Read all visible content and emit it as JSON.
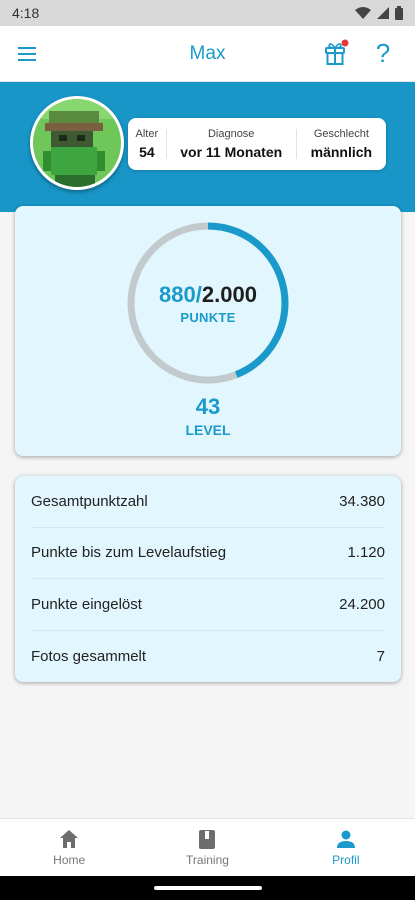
{
  "status_bar": {
    "time": "4:18"
  },
  "app_bar": {
    "title": "Max",
    "menu_icon": "hamburger-menu-icon",
    "gift_icon": "gift-icon",
    "help_glyph": "?",
    "accent": "#1a9acb",
    "notification_dot": "#e53935"
  },
  "profile": {
    "avatar_icon": "pixel-avatar-icon",
    "info": [
      {
        "label": "Alter",
        "value": "54"
      },
      {
        "label": "Diagnose",
        "value": "vor 11 Monaten"
      },
      {
        "label": "Geschlecht",
        "value": "männlich"
      }
    ]
  },
  "level_card": {
    "points_current": "880",
    "points_separator": "/",
    "points_max": "2.000",
    "points_label": "PUNKTE",
    "progress_fraction": 0.44,
    "level_number": "43",
    "level_label": "LEVEL",
    "ring_color": "#1a9acb",
    "ring_track_color": "#c3cacd"
  },
  "stats": [
    {
      "label": "Gesamtpunktzahl",
      "value": "34.380"
    },
    {
      "label": "Punkte bis zum Levelaufstieg",
      "value": "1.120"
    },
    {
      "label": "Punkte eingelöst",
      "value": "24.200"
    },
    {
      "label": "Fotos gesammelt",
      "value": "7"
    }
  ],
  "bottom_nav": {
    "items": [
      {
        "label": "Home",
        "icon": "home-icon",
        "active": false
      },
      {
        "label": "Training",
        "icon": "book-icon",
        "active": false
      },
      {
        "label": "Profil",
        "icon": "person-icon",
        "active": true
      }
    ]
  }
}
